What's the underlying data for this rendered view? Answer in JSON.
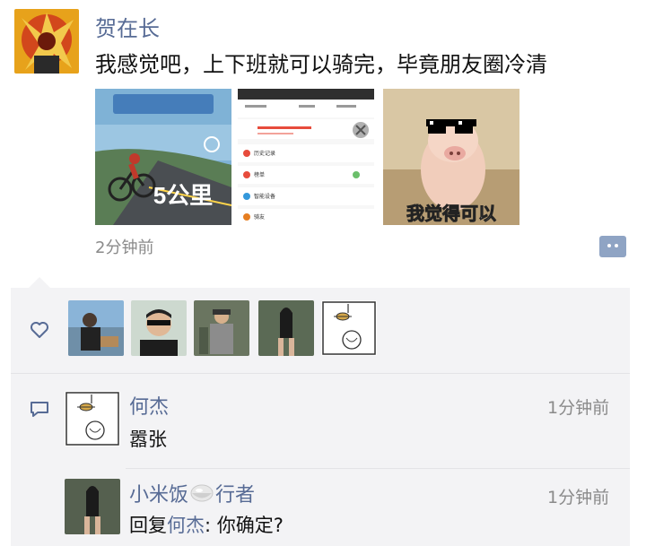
{
  "post": {
    "author": "贺在长",
    "text": "我感觉吧，上下班就可以骑完，毕竟朋友圈冷清",
    "time": "2分钟前",
    "images": [
      {
        "name": "cycling-poster",
        "text": "5公里"
      },
      {
        "name": "app-screenshot",
        "rows": [
          "历史记录",
          "榜单",
          "智能设备",
          "骑友"
        ]
      },
      {
        "name": "pig-meme",
        "caption": "我觉得可以"
      }
    ]
  },
  "likes": {
    "icon": "heart-outline-icon"
  },
  "comments": [
    {
      "author": "何杰",
      "time": "1分钟前",
      "text": "嚣张"
    },
    {
      "author": "小米饭",
      "author_suffix": "行者",
      "time": "1分钟前",
      "reply_prefix": "回复",
      "reply_to": "何杰",
      "text": ": 你确定?"
    }
  ],
  "colors": {
    "link": "#576b95",
    "panel": "#f3f3f5",
    "meta": "#8a8a8a"
  }
}
